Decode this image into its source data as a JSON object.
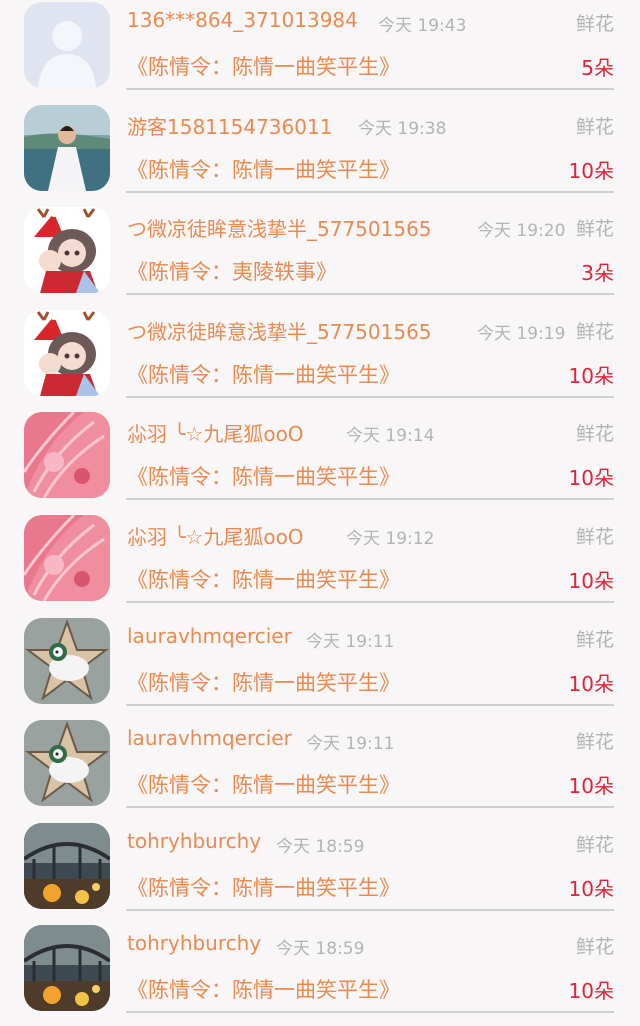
{
  "colors": {
    "name": "#eb8a4f",
    "time": "#b3b3b3",
    "count": "#e0243a",
    "background": "#f8f6f7"
  },
  "rows": [
    {
      "user": "136***864_371013984",
      "time": "今天 19:43",
      "gift": "鲜花",
      "book": "《陈情令：陈情一曲笑平生》",
      "count": "5朵",
      "avatar": "default-avatar"
    },
    {
      "user": "游客1581154736011",
      "time": "今天 19:38",
      "gift": "鲜花",
      "book": "《陈情令：陈情一曲笑平生》",
      "count": "10朵",
      "avatar": "bride-photo-avatar"
    },
    {
      "user": "つ微凉徒眸意浅挚半_577501565",
      "time": "今天 19:20",
      "gift": "鲜花",
      "book": "《陈情令：夷陵轶事》",
      "count": "3朵",
      "avatar": "anime-reindeer-avatar"
    },
    {
      "user": "つ微凉徒眸意浅挚半_577501565",
      "time": "今天 19:19",
      "gift": "鲜花",
      "book": "《陈情令：陈情一曲笑平生》",
      "count": "10朵",
      "avatar": "anime-reindeer-avatar"
    },
    {
      "user": "尛羽 ╰☆九尾狐ooO",
      "time": "今天 19:14",
      "gift": "鲜花",
      "book": "《陈情令：陈情一曲笑平生》",
      "count": "10朵",
      "avatar": "pink-feather-avatar"
    },
    {
      "user": "尛羽 ╰☆九尾狐ooO",
      "time": "今天 19:12",
      "gift": "鲜花",
      "book": "《陈情令：陈情一曲笑平生》",
      "count": "10朵",
      "avatar": "pink-feather-avatar"
    },
    {
      "user": "lauravhmqercier",
      "time": "今天 19:11",
      "gift": "鲜花",
      "book": "《陈情令：陈情一曲笑平生》",
      "count": "10朵",
      "avatar": "star-sheep-avatar"
    },
    {
      "user": "lauravhmqercier",
      "time": "今天 19:11",
      "gift": "鲜花",
      "book": "《陈情令：陈情一曲笑平生》",
      "count": "10朵",
      "avatar": "star-sheep-avatar"
    },
    {
      "user": "tohryhburchy",
      "time": "今天 18:59",
      "gift": "鲜花",
      "book": "《陈情令：陈情一曲笑平生》",
      "count": "10朵",
      "avatar": "bridge-scene-avatar"
    },
    {
      "user": "tohryhburchy",
      "time": "今天 18:59",
      "gift": "鲜花",
      "book": "《陈情令：陈情一曲笑平生》",
      "count": "10朵",
      "avatar": "bridge-scene-avatar"
    }
  ]
}
